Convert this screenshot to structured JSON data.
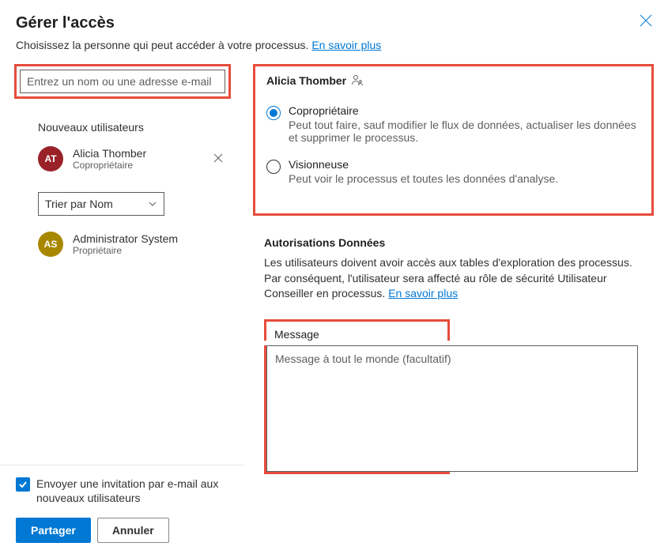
{
  "header": {
    "title": "Gérer l'accès",
    "subtext": "Choisissez la personne qui peut accéder à votre processus. ",
    "learn_more": "En savoir plus"
  },
  "search": {
    "placeholder": "Entrez un nom ou une adresse e-mail"
  },
  "left": {
    "new_users_label": "Nouveaux utilisateurs",
    "sort_label": "Trier par Nom",
    "users": [
      {
        "initials": "AT",
        "name": "Alicia Thomber",
        "role": "Copropriétaire",
        "removable": true
      },
      {
        "initials": "AS",
        "name": "Administrator System",
        "role": "Propriétaire",
        "removable": false
      }
    ]
  },
  "right": {
    "selected_user": "Alicia Thomber",
    "roles": [
      {
        "label": "Copropriétaire",
        "desc": "Peut tout faire, sauf modifier le flux de données, actualiser les données et supprimer le processus.",
        "checked": true
      },
      {
        "label": "Visionneuse",
        "desc": "Peut voir le processus et toutes les données d'analyse.",
        "checked": false
      }
    ],
    "perms_heading": "Autorisations Données",
    "perms_text": "Les utilisateurs doivent avoir accès aux tables d'exploration des processus. Par conséquent, l'utilisateur sera affecté au rôle de sécurité Utilisateur Conseiller en processus. ",
    "perms_learn_more": "En savoir plus",
    "message_label": "Message",
    "message_placeholder": "Message à tout le monde (facultatif)"
  },
  "footer": {
    "send_invite": "Envoyer une invitation par e-mail aux nouveaux utilisateurs",
    "share": "Partager",
    "cancel": "Annuler"
  }
}
